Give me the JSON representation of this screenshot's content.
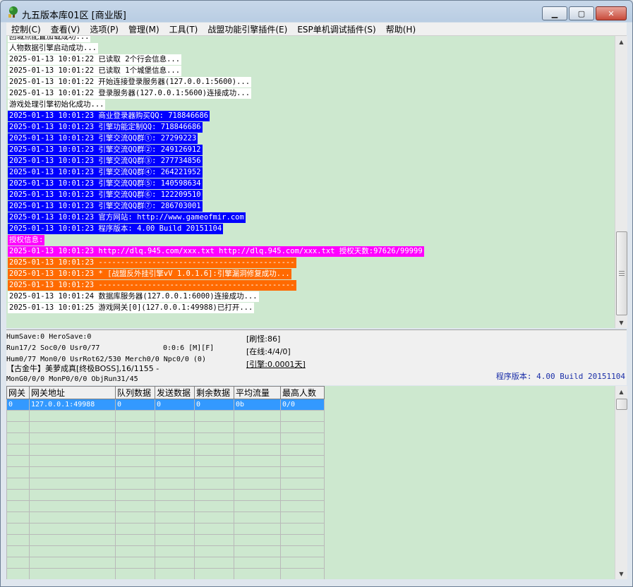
{
  "window": {
    "title": "九五版本库01区 [商业版]",
    "minimize_glyph": "▁",
    "maximize_glyph": "▢",
    "close_glyph": "✕"
  },
  "menu": [
    {
      "label": "控制(C)"
    },
    {
      "label": "查看(V)"
    },
    {
      "label": "选项(P)"
    },
    {
      "label": "管理(M)"
    },
    {
      "label": "工具(T)"
    },
    {
      "label": "战盟功能引擎插件(E)"
    },
    {
      "label": "ESP单机调试插件(S)"
    },
    {
      "label": "帮助(H)"
    }
  ],
  "log": {
    "lines": [
      {
        "text": "回城点配置加载成功...",
        "style": "plain"
      },
      {
        "text": "人物数据引擎启动成功...",
        "style": "plain"
      },
      {
        "text": "2025-01-13 10:01:22 已读取 2个行会信息...",
        "style": "plain"
      },
      {
        "text": "2025-01-13 10:01:22 已读取 1个城堡信息...",
        "style": "plain"
      },
      {
        "text": "2025-01-13 10:01:22 开始连接登录服务器(127.0.0.1:5600)...",
        "style": "plain"
      },
      {
        "text": "2025-01-13 10:01:22 登录服务器(127.0.0.1:5600)连接成功...",
        "style": "plain"
      },
      {
        "text": "游戏处理引擎初始化成功...",
        "style": "plain"
      },
      {
        "text": "2025-01-13 10:01:23 商业登录器购买QQ: 718846686",
        "style": "blue"
      },
      {
        "text": "2025-01-13 10:01:23 引擎功能定制QQ: 718846686",
        "style": "blue"
      },
      {
        "text": "2025-01-13 10:01:23 引擎交流QQ群①: 27299223",
        "style": "blue"
      },
      {
        "text": "2025-01-13 10:01:23 引擎交流QQ群②: 249126912",
        "style": "blue"
      },
      {
        "text": "2025-01-13 10:01:23 引擎交流QQ群③: 277734856",
        "style": "blue"
      },
      {
        "text": "2025-01-13 10:01:23 引擎交流QQ群④: 264221952",
        "style": "blue"
      },
      {
        "text": "2025-01-13 10:01:23 引擎交流QQ群⑤: 140598634",
        "style": "blue"
      },
      {
        "text": "2025-01-13 10:01:23 引擎交流QQ群⑥: 122209510",
        "style": "blue"
      },
      {
        "text": "2025-01-13 10:01:23 引擎交流QQ群⑦: 286703001",
        "style": "blue"
      },
      {
        "text": "2025-01-13 10:01:23 官方网站: http://www.gameofmir.com",
        "style": "blue"
      },
      {
        "text": "2025-01-13 10:01:23 程序版本: 4.00 Build 20151104",
        "style": "blue"
      },
      {
        "text": "授权信息:",
        "style": "magenta"
      },
      {
        "text": "2025-01-13 10:01:23 http://dlq.945.com/xxx.txt http://dlq.945.com/xxx.txt 授权天数:97626/99999",
        "style": "magenta"
      },
      {
        "text": "2025-01-13 10:01:23 --------------------------------------------",
        "style": "orange"
      },
      {
        "text": "2025-01-13 10:01:23 * [战盟反外挂引擎vV 1.0.1.6]:引擎漏洞修复成功...",
        "style": "orange"
      },
      {
        "text": "2025-01-13 10:01:23 --------------------------------------------",
        "style": "orange"
      },
      {
        "text": "2025-01-13 10:01:24 数据库服务器(127.0.0.1:6000)连接成功...",
        "style": "plain"
      },
      {
        "text": "2025-01-13 10:01:25 游戏网关[0](127.0.0.1:49988)已打开...",
        "style": "plain"
      }
    ]
  },
  "status": {
    "hum_save": "HumSave:0 HeroSave:0",
    "run": "Run17/2 Soc0/0 Usr0/77",
    "time": "0:0:6 [M][F]",
    "hum": "Hum0/77 Mon0/0 UsrRot62/530 Merch0/0 Npc0/0 (0)",
    "boss": "【古金牛】美萝成真[终极BOSS],16/1155 -",
    "mon": "MonG0/0/0 MonP0/0/0 ObjRun31/45",
    "refresh": "[刷怪:86]",
    "online": "[在线:4/4/0]",
    "engine": "[引擎:0.0001天]",
    "version": "程序版本: 4.00 Build 20151104"
  },
  "grid": {
    "columns": [
      "网关",
      "网关地址",
      "队列数据",
      "发送数据",
      "剩余数据",
      "平均流量",
      "最高人数"
    ],
    "rows": [
      [
        "0",
        "127.0.0.1:49988",
        "0",
        "0",
        "0",
        "0b",
        "0/0"
      ]
    ]
  },
  "colors": {
    "log_bg": "#cde8cf",
    "blue": "#0000ff",
    "magenta": "#ff00ff",
    "orange": "#ff6a00",
    "selection": "#3399ff"
  },
  "icons": {
    "app": "tree-app-icon",
    "scroll_up": "▲",
    "scroll_down": "▼"
  }
}
